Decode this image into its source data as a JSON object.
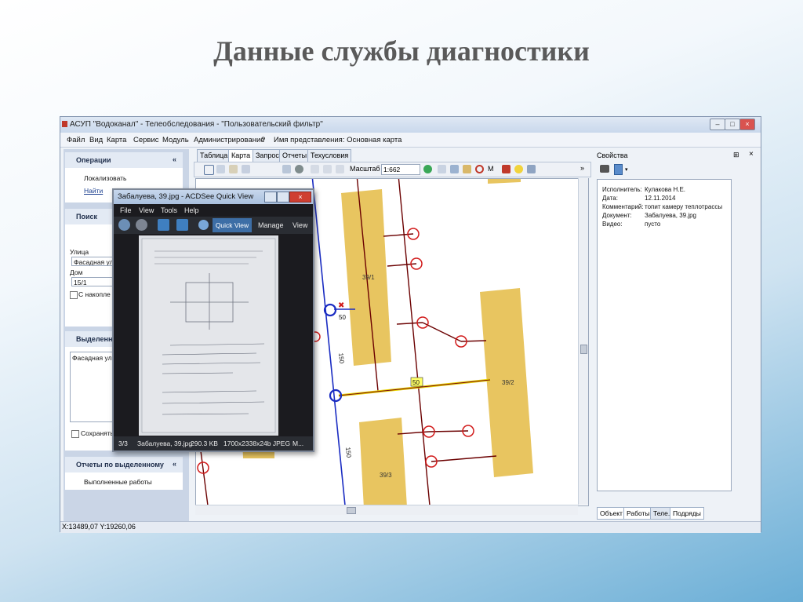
{
  "slide": {
    "title": "Данные службы диагностики"
  },
  "window": {
    "title": "АСУП \"Водоканал\" - Телеобследования - \"Пользовательский фильтр\"",
    "menu": [
      "Файл",
      "Вид",
      "Карта",
      "Сервис",
      "Модуль",
      "Администрирование",
      "?"
    ],
    "representation": "Имя представления:  Основная карта"
  },
  "left_panel": {
    "operations": {
      "header": "Операции",
      "items": [
        "Локализовать",
        "Найти"
      ]
    },
    "search": {
      "header": "Поиск",
      "street_label": "Улица",
      "street_value": "Фасадная ул.",
      "house_label": "Дом",
      "house_value": "15/1",
      "accumulate_label": "С накопле"
    },
    "selected": {
      "header": "Выделенно",
      "list_item": "Фасадная ул.",
      "save_label": "Сохранять"
    },
    "reports": {
      "header": "Отчеты по выделенному",
      "item": "Выполненные работы"
    }
  },
  "tabs": [
    "Таблица",
    "Карта",
    "Запрос",
    "Отчеты",
    "Техусловия"
  ],
  "toolbar": {
    "scale_label": "Масштаб",
    "scale_value": "1:662",
    "m_label": "M"
  },
  "map": {
    "buildings": [
      "39/1",
      "39/2",
      "39/3"
    ],
    "labels": {
      "pipe_top": "50",
      "pipe_mid": "50",
      "length_a": "150",
      "length_b": "150"
    }
  },
  "acdsee": {
    "title": "Забалуева, 39.jpg - ACDSee Quick View",
    "menu": [
      "File",
      "View",
      "Tools",
      "Help"
    ],
    "buttons": {
      "quick_view": "Quick View",
      "manage": "Manage",
      "view": "View"
    },
    "status": [
      "3/3",
      "Забалуева, 39.jpg",
      "290.3 KB",
      "1700x2338x24b JPEG",
      "M..."
    ]
  },
  "right_panel": {
    "header": "Свойства",
    "props": [
      {
        "key": "Исполнитель:",
        "value": "Кулакова Н.Е."
      },
      {
        "key": "Дата:",
        "value": "12.11.2014"
      },
      {
        "key": "Комментарий:",
        "value": "топит камеру теплотрассы"
      },
      {
        "key": "Документ:",
        "value": "Забалуева, 39.jpg"
      },
      {
        "key": "Видео:",
        "value": "пусто"
      }
    ],
    "tabs": [
      "Объект",
      "Работы",
      "Теле.",
      "Подряды"
    ]
  },
  "status": {
    "coords": "X:13489,07 Y:19260,06"
  }
}
